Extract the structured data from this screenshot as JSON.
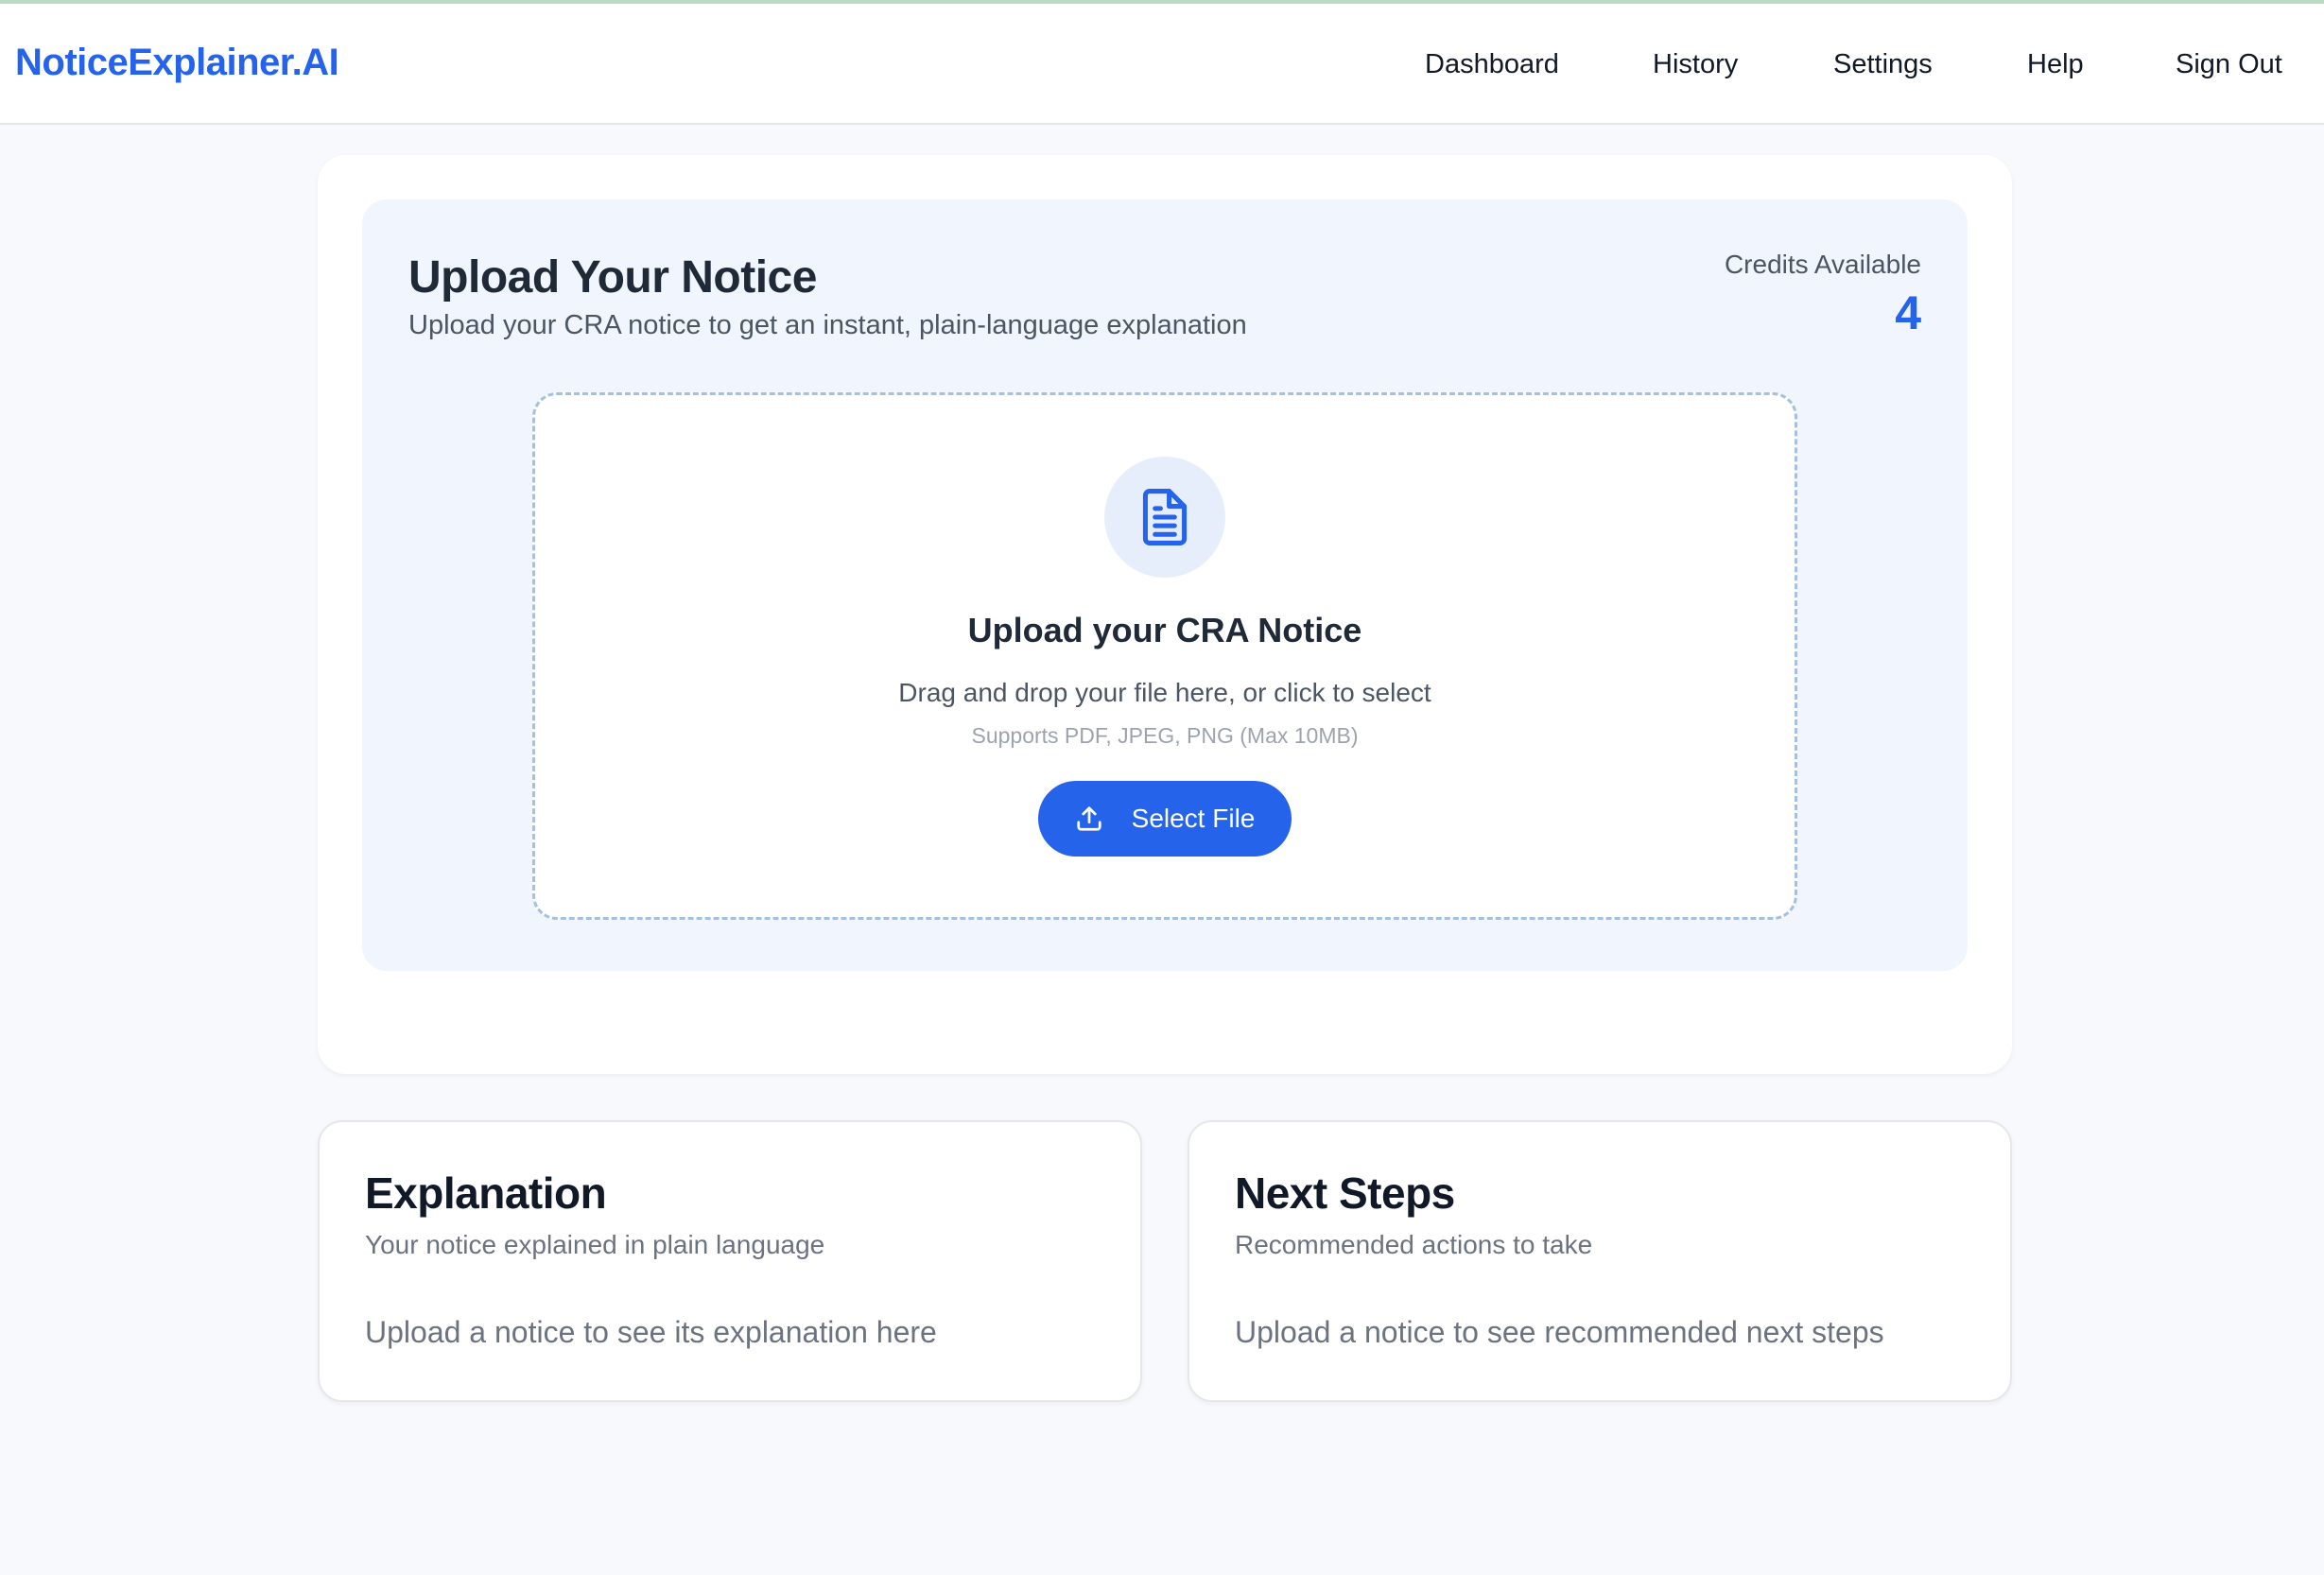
{
  "brand": "NoticeExplainer.AI",
  "nav": {
    "dashboard": "Dashboard",
    "history": "History",
    "settings": "Settings",
    "help": "Help",
    "signout": "Sign Out"
  },
  "upload": {
    "title": "Upload Your Notice",
    "subtitle": "Upload your CRA notice to get an instant, plain-language explanation",
    "credits_label": "Credits Available",
    "credits_value": "4",
    "dropzone": {
      "icon": "document-icon",
      "title": "Upload your CRA Notice",
      "description": "Drag and drop your file here, or click to select",
      "hint": "Supports PDF, JPEG, PNG (Max 10MB)",
      "button_label": "Select File",
      "button_icon": "upload-icon"
    }
  },
  "explanation": {
    "title": "Explanation",
    "subtitle": "Your notice explained in plain language",
    "empty": "Upload a notice to see its explanation here"
  },
  "next_steps": {
    "title": "Next Steps",
    "subtitle": "Recommended actions to take",
    "empty": "Upload a notice to see recommended next steps"
  },
  "colors": {
    "accent": "#2563eb",
    "panel_bg": "#f1f5fd",
    "dropzone_border": "#a6bfe3"
  }
}
